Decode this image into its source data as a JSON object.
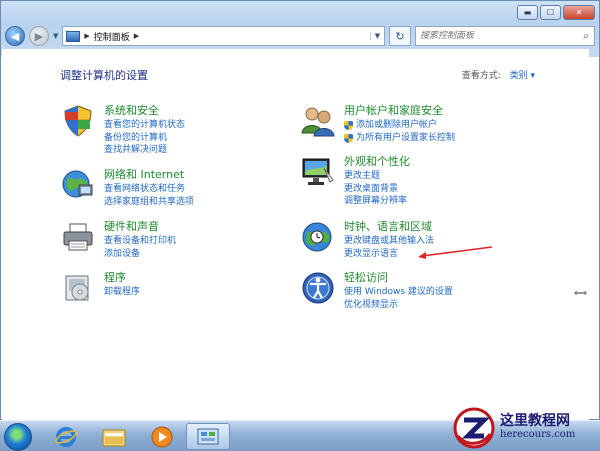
{
  "window": {
    "min_label": "▬",
    "max_label": "☐",
    "close_label": "✕"
  },
  "address": {
    "breadcrumb": "控制面板",
    "search_placeholder": "搜索控制面板"
  },
  "page": {
    "title": "调整计算机的设置",
    "view_by_label": "查看方式:",
    "view_by_value": "类别 ▾"
  },
  "categories": [
    {
      "title": "系统和安全",
      "icon": "shield-icon",
      "links": [
        "查看您的计算机状态",
        "备份您的计算机",
        "查找并解决问题"
      ]
    },
    {
      "title": "网络和 Internet",
      "icon": "network-globe-icon",
      "links": [
        "查看网络状态和任务",
        "选择家庭组和共享选项"
      ]
    },
    {
      "title": "硬件和声音",
      "icon": "printer-icon",
      "links": [
        "查看设备和打印机",
        "添加设备"
      ]
    },
    {
      "title": "程序",
      "icon": "programs-icon",
      "links": [
        "卸载程序"
      ]
    },
    {
      "title": "用户帐户和家庭安全",
      "icon": "users-icon",
      "links": [
        "添加或删除用户帐户",
        "为所有用户设置家长控制"
      ]
    },
    {
      "title": "外观和个性化",
      "icon": "monitor-icon",
      "links": [
        "更改主题",
        "更改桌面背景",
        "调整屏幕分辨率"
      ]
    },
    {
      "title": "时钟、语言和区域",
      "icon": "clock-globe-icon",
      "links": [
        "更改键盘或其他输入法",
        "更改显示语言"
      ]
    },
    {
      "title": "轻松访问",
      "icon": "accessibility-icon",
      "links": [
        "使用 Windows 建议的设置",
        "优化视频显示"
      ]
    }
  ],
  "taskbar": {
    "items": [
      "start-orb-icon",
      "internet-explorer-icon",
      "file-explorer-icon",
      "media-player-icon",
      "control-panel-icon"
    ]
  },
  "watermark": {
    "title": "这里教程网",
    "url": "herecours.com"
  },
  "colors": {
    "link": "#1f68c4",
    "category_title": "#1e8a2d",
    "page_title": "#1e3287",
    "annotation_arrow": "#d9272c"
  }
}
